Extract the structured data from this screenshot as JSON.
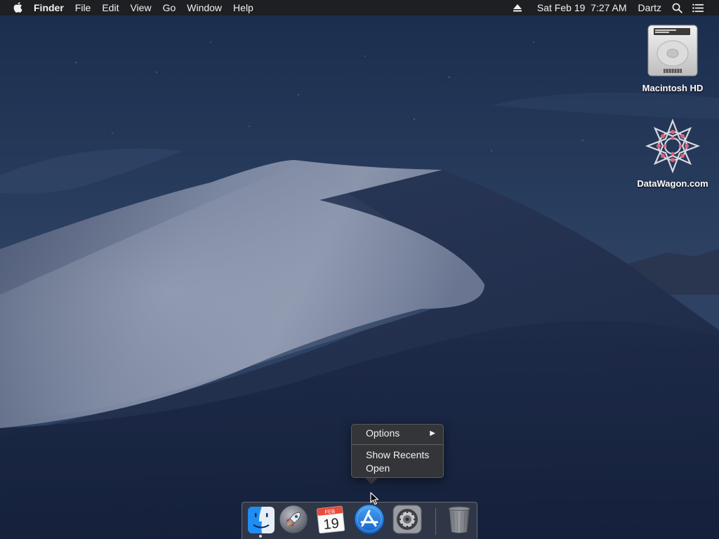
{
  "menubar": {
    "apple_icon": "apple-logo-icon",
    "app_name": "Finder",
    "menus": [
      "File",
      "Edit",
      "View",
      "Go",
      "Window",
      "Help"
    ],
    "status": {
      "eject_icon": "eject-icon",
      "datetime": "Sat Feb 19  7:27 AM",
      "user": "Dartz",
      "spotlight_icon": "search-icon",
      "notification_icon": "notification-center-icon"
    }
  },
  "desktop": {
    "icons": [
      {
        "label": "Macintosh HD",
        "icon": "hard-drive-icon"
      },
      {
        "label": "DataWagon.com",
        "icon": "network-volume-icon"
      }
    ]
  },
  "context_menu": {
    "options_label": "Options",
    "options_arrow": "▶",
    "show_recents_label": "Show Recents",
    "open_label": "Open"
  },
  "dock": {
    "apps": [
      {
        "name": "Finder",
        "icon": "finder-icon",
        "running": true
      },
      {
        "name": "Launchpad",
        "icon": "launchpad-rocket-icon",
        "running": false
      },
      {
        "name": "Calendar",
        "icon": "calendar-icon",
        "running": false
      },
      {
        "name": "App Store",
        "icon": "app-store-icon",
        "running": false
      },
      {
        "name": "System Preferences",
        "icon": "gear-icon",
        "running": false
      },
      {
        "name": "Trash",
        "icon": "trash-icon",
        "running": false
      }
    ],
    "calendar_month": "FEB",
    "calendar_day": "19"
  },
  "colors": {
    "menubar_bg": "#1e1e20",
    "sky_top": "#1b2d4d",
    "dune_highlight": "#8590a8",
    "context_menu_bg": "#363638"
  }
}
